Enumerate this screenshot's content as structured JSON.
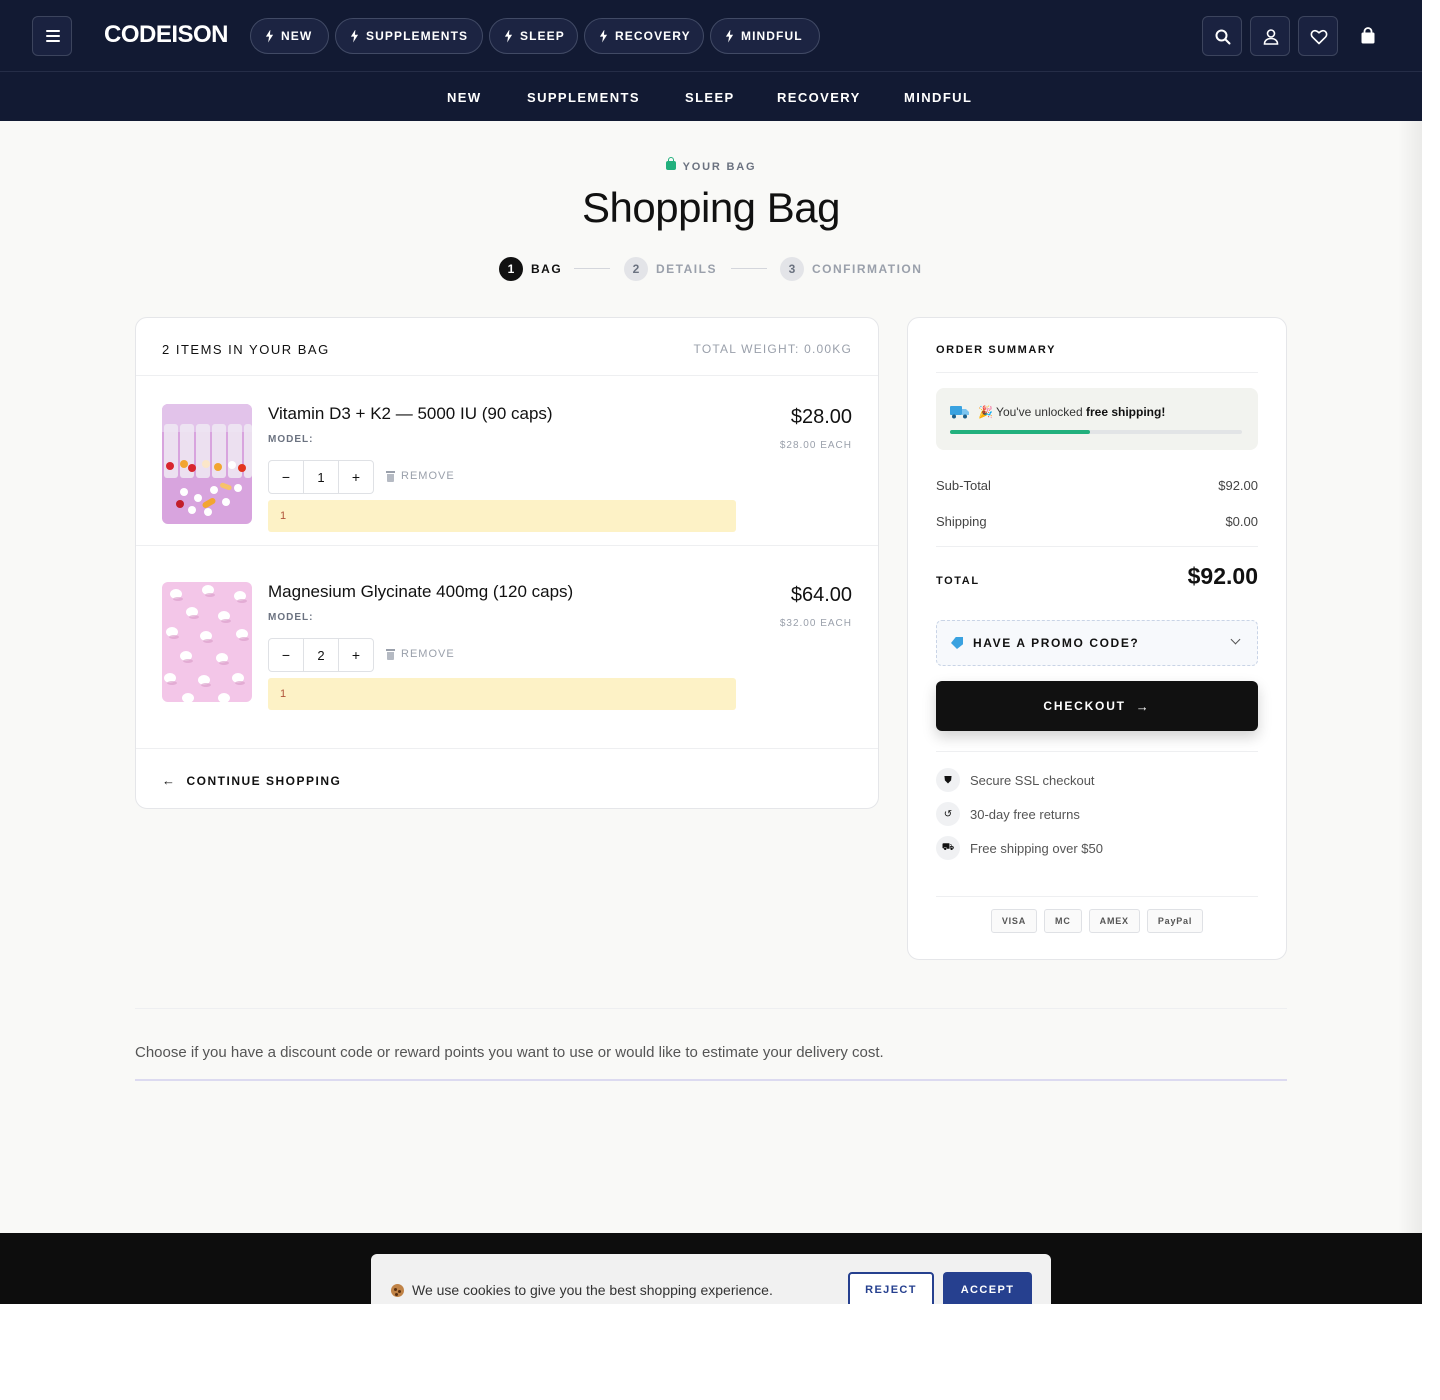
{
  "header": {
    "logo": "CODEISON",
    "pills": [
      "NEW",
      "SUPPLEMENTS",
      "SLEEP",
      "RECOVERY",
      "MINDFUL"
    ],
    "icons": [
      "menu-icon",
      "search-icon",
      "user-icon",
      "heart-icon",
      "shopping-bag-icon"
    ]
  },
  "subnav": [
    "NEW",
    "SUPPLEMENTS",
    "SLEEP",
    "RECOVERY",
    "MINDFUL"
  ],
  "page": {
    "eyebrow": "YOUR BAG",
    "title": "Shopping Bag"
  },
  "steps": [
    {
      "num": "1",
      "label": "BAG",
      "state": "active"
    },
    {
      "num": "2",
      "label": "DETAILS",
      "state": "inactive"
    },
    {
      "num": "3",
      "label": "CONFIRMATION",
      "state": "inactive"
    }
  ],
  "cart": {
    "count_label": "2 ITEMS IN YOUR BAG",
    "weight_label": "TOTAL WEIGHT: 0.00KG",
    "items": [
      {
        "name": "Vitamin D3 + K2 — 5000 IU (90 caps)",
        "model": "MODEL:",
        "qty": "1",
        "remove": "REMOVE",
        "note": "1",
        "price": "$28.00",
        "each": "$28.00 EACH"
      },
      {
        "name": "Magnesium Glycinate 400mg (120 caps)",
        "model": "MODEL:",
        "qty": "2",
        "remove": "REMOVE",
        "note": "1",
        "price": "$64.00",
        "each": "$32.00 EACH"
      }
    ],
    "qty_minus": "−",
    "qty_plus": "+",
    "continue_label": "CONTINUE SHOPPING"
  },
  "summary": {
    "title": "ORDER SUMMARY",
    "shipping_note_prefix": "🎉 You've unlocked ",
    "shipping_note_bold": "free shipping!",
    "shipping_progress": 0.48,
    "subtotal_label": "Sub-Total",
    "subtotal_value": "$92.00",
    "shipping_label": "Shipping",
    "shipping_value": "$0.00",
    "total_label": "TOTAL",
    "total_value": "$92.00",
    "promo_label": "HAVE A PROMO CODE?",
    "checkout_label": "CHECKOUT",
    "trust": [
      {
        "icon": "shield-icon",
        "glyph": "⛊",
        "text": "Secure SSL checkout"
      },
      {
        "icon": "return-icon",
        "glyph": "↺",
        "text": "30-day free returns"
      },
      {
        "icon": "truck-icon",
        "glyph": "⛟",
        "text": "Free shipping over $50"
      }
    ],
    "payments": [
      "VISA",
      "MC",
      "AMEX",
      "PayPal"
    ]
  },
  "info": {
    "text": "Choose if you have a discount code or reward points you want to use or would like to estimate your delivery cost."
  },
  "cookie": {
    "text": "We use cookies to give you the best shopping experience.",
    "reject": "REJECT",
    "accept": "ACCEPT"
  },
  "colors": {
    "nav_bg": "#121a33",
    "accent_green": "#22b07d",
    "note_bg": "#fdf2c6",
    "cookie_button": "#26408f"
  }
}
